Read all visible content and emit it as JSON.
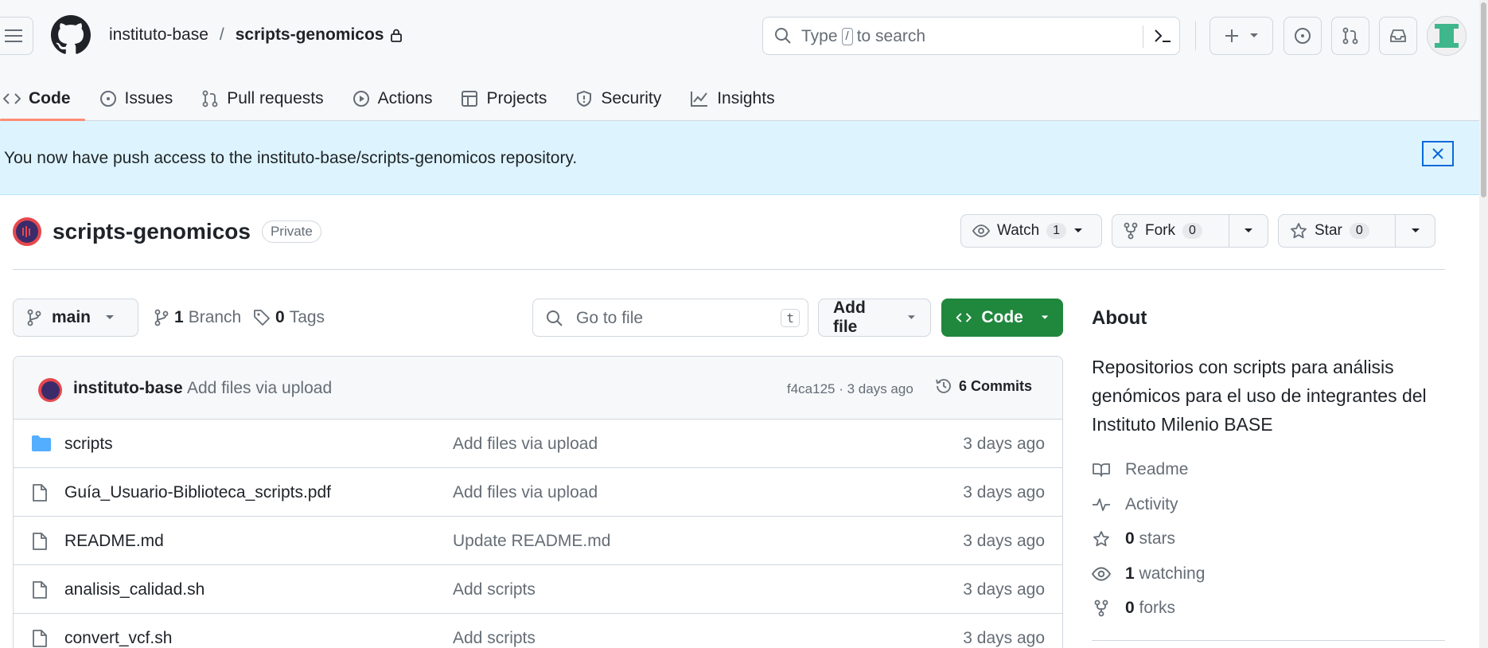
{
  "header": {
    "owner": "instituto-base",
    "separator": "/",
    "repo": "scripts-genomicos",
    "search_prefix": "Type",
    "search_key": "/",
    "search_suffix": "to search"
  },
  "tabs": [
    {
      "label": "Code",
      "icon": "code-icon"
    },
    {
      "label": "Issues",
      "icon": "issue-icon"
    },
    {
      "label": "Pull requests",
      "icon": "pull-request-icon"
    },
    {
      "label": "Actions",
      "icon": "play-icon"
    },
    {
      "label": "Projects",
      "icon": "table-icon"
    },
    {
      "label": "Security",
      "icon": "shield-icon"
    },
    {
      "label": "Insights",
      "icon": "graph-icon"
    }
  ],
  "banner": {
    "text": "You now have push access to the instituto-base/scripts-genomicos repository."
  },
  "repo": {
    "name": "scripts-genomicos",
    "visibility": "Private",
    "watch_label": "Watch",
    "watch_count": "1",
    "fork_label": "Fork",
    "fork_count": "0",
    "star_label": "Star",
    "star_count": "0"
  },
  "controls": {
    "branch": "main",
    "branches_count": "1",
    "branches_label": "Branch",
    "tags_count": "0",
    "tags_label": "Tags",
    "goto_placeholder": "Go to file",
    "goto_key": "t",
    "add_file": "Add file",
    "code": "Code"
  },
  "latest_commit": {
    "author": "instituto-base",
    "message": "Add files via upload",
    "hash_age": "f4ca125 · 3 days ago",
    "commits": "6 Commits"
  },
  "files": [
    {
      "name": "scripts",
      "type": "folder",
      "message": "Add files via upload",
      "date": "3 days ago"
    },
    {
      "name": "Guía_Usuario-Biblioteca_scripts.pdf",
      "type": "file",
      "message": "Add files via upload",
      "date": "3 days ago"
    },
    {
      "name": "README.md",
      "type": "file",
      "message": "Update README.md",
      "date": "3 days ago"
    },
    {
      "name": "analisis_calidad.sh",
      "type": "file",
      "message": "Add scripts",
      "date": "3 days ago"
    },
    {
      "name": "convert_vcf.sh",
      "type": "file",
      "message": "Add scripts",
      "date": "3 days ago"
    }
  ],
  "about": {
    "title": "About",
    "description": "Repositorios con scripts para análisis genómicos para el uso de integrantes del Instituto Milenio BASE",
    "readme": "Readme",
    "activity": "Activity",
    "stars_count": "0",
    "stars_label": "stars",
    "watching_count": "1",
    "watching_label": "watching",
    "forks_count": "0",
    "forks_label": "forks"
  },
  "colors": {
    "accent_tab": "#fd8c73",
    "primary_green": "#1f883d",
    "banner_bg": "#ddf4ff",
    "link_blue": "#0969da"
  }
}
